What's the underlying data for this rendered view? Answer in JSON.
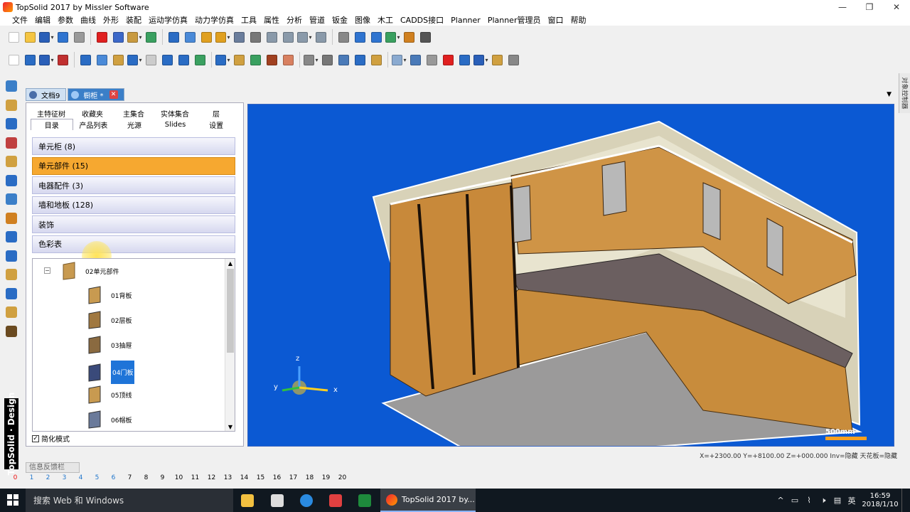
{
  "window": {
    "title": "TopSolid 2017 by Missler Software",
    "minimize": "—",
    "restore": "❐",
    "close": "✕"
  },
  "menu": [
    "文件",
    "编辑",
    "参数",
    "曲线",
    "外形",
    "装配",
    "运动学仿真",
    "动力学仿真",
    "工具",
    "属性",
    "分析",
    "管道",
    "钣金",
    "图像",
    "木工",
    "CADDS接口",
    "Planner",
    "Planner管理员",
    "窗口",
    "帮助"
  ],
  "toolbar1_colors": [
    "#fff",
    "#f5c542",
    "#2a5fb8",
    "#2f74d0",
    "#999",
    "#e02020",
    "#3c68c8",
    "#c89a40",
    "#3aa060",
    "#2a6cc4",
    "#4a8ad8",
    "#e0a020",
    "#e0a020",
    "#6a7d9c",
    "#777",
    "#8a9aaa",
    "#8a9aaa",
    "#8a9aaa",
    "#8a9aaa",
    "#888",
    "#2f74d0",
    "#2f74d0",
    "#3aa060",
    "#d08020",
    "#555"
  ],
  "toolbar2_colors": [
    "#fff",
    "#2a6cc4",
    "#2a5fb8",
    "#c03030",
    "#2a6cc4",
    "#4a8ad8",
    "#d0a040",
    "#2a6cc4",
    "#ccc",
    "#2a6cc4",
    "#2a6cc4",
    "#3aa060",
    "#2a6cc4",
    "#d0a040",
    "#3aa060",
    "#a04020",
    "#d88060",
    "#888",
    "#777",
    "#4a7ab8",
    "#2a6cc4",
    "#d0a040",
    "#8aaad0",
    "#4a7ab8",
    "#999",
    "#e02020",
    "#2a6cc4",
    "#2a5fb8",
    "#d0a040",
    "#888"
  ],
  "lefttool_colors": [
    "#3b7fc8",
    "#d0a040",
    "#2a6cc4",
    "#c04040",
    "#d0a040",
    "#2a6cc4",
    "#3b7fc8",
    "#d08020",
    "#2a6cc4",
    "#2a6cc4",
    "#d0a040",
    "#2a6cc4",
    "#d0a040",
    "#6a4a20"
  ],
  "brand": "TopSolid · Design",
  "rightstrip": "对象控制器",
  "doctabs": [
    {
      "label": "文档9",
      "active": false
    },
    {
      "label": "橱柜 *",
      "active": true
    }
  ],
  "tab_menu_arrow": "▼",
  "panel": {
    "tabs_row1": [
      "主特征树",
      "收藏夹",
      "主集合",
      "实体集合",
      "层"
    ],
    "tabs_row2": [
      "目录",
      "产品列表",
      "光源",
      "Slides",
      "设置"
    ],
    "categories": [
      "单元柜 (8)",
      "单元部件 (15)",
      "电器配件 (3)",
      "墙和地板 (128)",
      "装饰",
      "色彩表"
    ],
    "active_category": 1,
    "tree": {
      "root": "02单元部件",
      "expander": "−",
      "items": [
        {
          "label": "01背板",
          "color": "#c89a50"
        },
        {
          "label": "02层板",
          "color": "#a07840"
        },
        {
          "label": "03抽屉",
          "color": "#8a6a40"
        },
        {
          "label": "04门板",
          "color": "#3a4a7a",
          "selected": true
        },
        {
          "label": "05顶线",
          "color": "#c89a50"
        },
        {
          "label": "06帽板",
          "color": "#6a7a9a"
        }
      ]
    },
    "simplify": {
      "label": "简化模式",
      "checked": "✓"
    }
  },
  "viewport": {
    "scale": "500mm",
    "axes": {
      "x": "x",
      "y": "y",
      "z": "z"
    }
  },
  "coords": "X=+2300.00  Y=+8100.00  Z=+000.000  Inv=隐藏  天花板=隐藏",
  "feedback": "信息反馈栏",
  "pages": [
    "0",
    "1",
    "2",
    "3",
    "4",
    "5",
    "6",
    "7",
    "8",
    "9",
    "10",
    "11",
    "12",
    "13",
    "14",
    "15",
    "16",
    "17",
    "18",
    "19",
    "20"
  ],
  "taskbar": {
    "search": "搜索 Web 和 Windows",
    "active_app": "TopSolid 2017 by...",
    "tray": [
      "^",
      "▭",
      "⌇",
      "🕨",
      "▤",
      "英"
    ],
    "time": "16:59",
    "date": "2018/1/10"
  }
}
